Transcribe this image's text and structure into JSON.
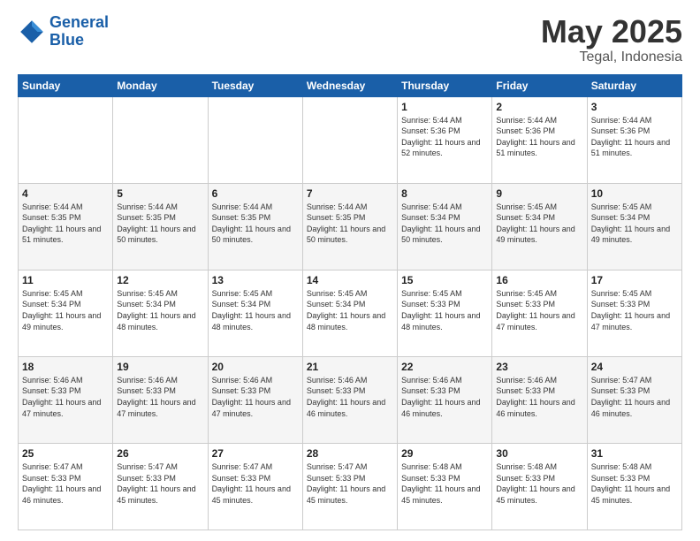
{
  "header": {
    "logo_line1": "General",
    "logo_line2": "Blue",
    "month": "May 2025",
    "location": "Tegal, Indonesia"
  },
  "days_of_week": [
    "Sunday",
    "Monday",
    "Tuesday",
    "Wednesday",
    "Thursday",
    "Friday",
    "Saturday"
  ],
  "weeks": [
    [
      {
        "num": "",
        "sunrise": "",
        "sunset": "",
        "daylight": ""
      },
      {
        "num": "",
        "sunrise": "",
        "sunset": "",
        "daylight": ""
      },
      {
        "num": "",
        "sunrise": "",
        "sunset": "",
        "daylight": ""
      },
      {
        "num": "",
        "sunrise": "",
        "sunset": "",
        "daylight": ""
      },
      {
        "num": "1",
        "sunrise": "Sunrise: 5:44 AM",
        "sunset": "Sunset: 5:36 PM",
        "daylight": "Daylight: 11 hours and 52 minutes."
      },
      {
        "num": "2",
        "sunrise": "Sunrise: 5:44 AM",
        "sunset": "Sunset: 5:36 PM",
        "daylight": "Daylight: 11 hours and 51 minutes."
      },
      {
        "num": "3",
        "sunrise": "Sunrise: 5:44 AM",
        "sunset": "Sunset: 5:36 PM",
        "daylight": "Daylight: 11 hours and 51 minutes."
      }
    ],
    [
      {
        "num": "4",
        "sunrise": "Sunrise: 5:44 AM",
        "sunset": "Sunset: 5:35 PM",
        "daylight": "Daylight: 11 hours and 51 minutes."
      },
      {
        "num": "5",
        "sunrise": "Sunrise: 5:44 AM",
        "sunset": "Sunset: 5:35 PM",
        "daylight": "Daylight: 11 hours and 50 minutes."
      },
      {
        "num": "6",
        "sunrise": "Sunrise: 5:44 AM",
        "sunset": "Sunset: 5:35 PM",
        "daylight": "Daylight: 11 hours and 50 minutes."
      },
      {
        "num": "7",
        "sunrise": "Sunrise: 5:44 AM",
        "sunset": "Sunset: 5:35 PM",
        "daylight": "Daylight: 11 hours and 50 minutes."
      },
      {
        "num": "8",
        "sunrise": "Sunrise: 5:44 AM",
        "sunset": "Sunset: 5:34 PM",
        "daylight": "Daylight: 11 hours and 50 minutes."
      },
      {
        "num": "9",
        "sunrise": "Sunrise: 5:45 AM",
        "sunset": "Sunset: 5:34 PM",
        "daylight": "Daylight: 11 hours and 49 minutes."
      },
      {
        "num": "10",
        "sunrise": "Sunrise: 5:45 AM",
        "sunset": "Sunset: 5:34 PM",
        "daylight": "Daylight: 11 hours and 49 minutes."
      }
    ],
    [
      {
        "num": "11",
        "sunrise": "Sunrise: 5:45 AM",
        "sunset": "Sunset: 5:34 PM",
        "daylight": "Daylight: 11 hours and 49 minutes."
      },
      {
        "num": "12",
        "sunrise": "Sunrise: 5:45 AM",
        "sunset": "Sunset: 5:34 PM",
        "daylight": "Daylight: 11 hours and 48 minutes."
      },
      {
        "num": "13",
        "sunrise": "Sunrise: 5:45 AM",
        "sunset": "Sunset: 5:34 PM",
        "daylight": "Daylight: 11 hours and 48 minutes."
      },
      {
        "num": "14",
        "sunrise": "Sunrise: 5:45 AM",
        "sunset": "Sunset: 5:34 PM",
        "daylight": "Daylight: 11 hours and 48 minutes."
      },
      {
        "num": "15",
        "sunrise": "Sunrise: 5:45 AM",
        "sunset": "Sunset: 5:33 PM",
        "daylight": "Daylight: 11 hours and 48 minutes."
      },
      {
        "num": "16",
        "sunrise": "Sunrise: 5:45 AM",
        "sunset": "Sunset: 5:33 PM",
        "daylight": "Daylight: 11 hours and 47 minutes."
      },
      {
        "num": "17",
        "sunrise": "Sunrise: 5:45 AM",
        "sunset": "Sunset: 5:33 PM",
        "daylight": "Daylight: 11 hours and 47 minutes."
      }
    ],
    [
      {
        "num": "18",
        "sunrise": "Sunrise: 5:46 AM",
        "sunset": "Sunset: 5:33 PM",
        "daylight": "Daylight: 11 hours and 47 minutes."
      },
      {
        "num": "19",
        "sunrise": "Sunrise: 5:46 AM",
        "sunset": "Sunset: 5:33 PM",
        "daylight": "Daylight: 11 hours and 47 minutes."
      },
      {
        "num": "20",
        "sunrise": "Sunrise: 5:46 AM",
        "sunset": "Sunset: 5:33 PM",
        "daylight": "Daylight: 11 hours and 47 minutes."
      },
      {
        "num": "21",
        "sunrise": "Sunrise: 5:46 AM",
        "sunset": "Sunset: 5:33 PM",
        "daylight": "Daylight: 11 hours and 46 minutes."
      },
      {
        "num": "22",
        "sunrise": "Sunrise: 5:46 AM",
        "sunset": "Sunset: 5:33 PM",
        "daylight": "Daylight: 11 hours and 46 minutes."
      },
      {
        "num": "23",
        "sunrise": "Sunrise: 5:46 AM",
        "sunset": "Sunset: 5:33 PM",
        "daylight": "Daylight: 11 hours and 46 minutes."
      },
      {
        "num": "24",
        "sunrise": "Sunrise: 5:47 AM",
        "sunset": "Sunset: 5:33 PM",
        "daylight": "Daylight: 11 hours and 46 minutes."
      }
    ],
    [
      {
        "num": "25",
        "sunrise": "Sunrise: 5:47 AM",
        "sunset": "Sunset: 5:33 PM",
        "daylight": "Daylight: 11 hours and 46 minutes."
      },
      {
        "num": "26",
        "sunrise": "Sunrise: 5:47 AM",
        "sunset": "Sunset: 5:33 PM",
        "daylight": "Daylight: 11 hours and 45 minutes."
      },
      {
        "num": "27",
        "sunrise": "Sunrise: 5:47 AM",
        "sunset": "Sunset: 5:33 PM",
        "daylight": "Daylight: 11 hours and 45 minutes."
      },
      {
        "num": "28",
        "sunrise": "Sunrise: 5:47 AM",
        "sunset": "Sunset: 5:33 PM",
        "daylight": "Daylight: 11 hours and 45 minutes."
      },
      {
        "num": "29",
        "sunrise": "Sunrise: 5:48 AM",
        "sunset": "Sunset: 5:33 PM",
        "daylight": "Daylight: 11 hours and 45 minutes."
      },
      {
        "num": "30",
        "sunrise": "Sunrise: 5:48 AM",
        "sunset": "Sunset: 5:33 PM",
        "daylight": "Daylight: 11 hours and 45 minutes."
      },
      {
        "num": "31",
        "sunrise": "Sunrise: 5:48 AM",
        "sunset": "Sunset: 5:33 PM",
        "daylight": "Daylight: 11 hours and 45 minutes."
      }
    ]
  ]
}
